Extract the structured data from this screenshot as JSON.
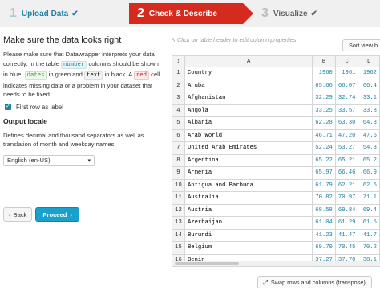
{
  "steps": [
    {
      "num": "1",
      "label": "Upload Data",
      "done": true
    },
    {
      "num": "2",
      "label": "Check & Describe",
      "done": true
    },
    {
      "num": "3",
      "label": "Visualize",
      "done": true
    }
  ],
  "left": {
    "heading": "Make sure the data looks right",
    "desc_1": "Please make sure that Datawrapper interprets your data correctly. In the table ",
    "code_number": "number",
    "desc_2": " columns should be shown in blue, ",
    "code_dates": "dates",
    "desc_3": " in green and ",
    "code_text": "text",
    "desc_4": " in black. A ",
    "code_red": "red",
    "desc_5": " cell indicates missing data or a problem in your dataset that needs to be fixed.",
    "first_row_label": "First row as label",
    "first_row_checked": true,
    "locale_heading": "Output locale",
    "locale_desc": "Defines decimal and thousand separators as well as translation of month and weekday names.",
    "locale_value": "English (en-US)",
    "back_label": "Back",
    "proceed_label": "Proceed"
  },
  "hint": "Click on table header to edit column properties",
  "sort_label": "Sort view b",
  "transpose_label": "Swap rows and columns (transpose)",
  "table": {
    "corner": "↕",
    "col_letters": [
      "A",
      "B",
      "C",
      "D"
    ],
    "header_row": {
      "rn": "1",
      "cells": [
        "Country",
        "1960",
        "1961",
        "1962"
      ]
    },
    "rows": [
      {
        "rn": "2",
        "cells": [
          "Aruba",
          "65.66",
          "66.07",
          "66.4"
        ]
      },
      {
        "rn": "3",
        "cells": [
          "Afghanistan",
          "32.29",
          "32.74",
          "33.1"
        ]
      },
      {
        "rn": "4",
        "cells": [
          "Angola",
          "33.25",
          "33.57",
          "33.8"
        ]
      },
      {
        "rn": "5",
        "cells": [
          "Albania",
          "62.28",
          "63.30",
          "64.3"
        ]
      },
      {
        "rn": "6",
        "cells": [
          "Arab World",
          "46.71",
          "47.20",
          "47.6"
        ]
      },
      {
        "rn": "7",
        "cells": [
          "United Arab Emirates",
          "52.24",
          "53.27",
          "54.3"
        ]
      },
      {
        "rn": "8",
        "cells": [
          "Argentina",
          "65.22",
          "65.21",
          "65.2"
        ]
      },
      {
        "rn": "9",
        "cells": [
          "Armenia",
          "65.97",
          "66.46",
          "66.9"
        ]
      },
      {
        "rn": "10",
        "cells": [
          "Antigua and Barbuda",
          "61.79",
          "62.21",
          "62.6"
        ]
      },
      {
        "rn": "11",
        "cells": [
          "Australia",
          "70.82",
          "70.97",
          "71.1"
        ]
      },
      {
        "rn": "12",
        "cells": [
          "Austria",
          "68.58",
          "69.84",
          "69.4"
        ]
      },
      {
        "rn": "13",
        "cells": [
          "Azerbaijan",
          "61.04",
          "61.29",
          "61.5"
        ]
      },
      {
        "rn": "14",
        "cells": [
          "Burundi",
          "41.23",
          "41.47",
          "41.7"
        ]
      },
      {
        "rn": "15",
        "cells": [
          "Belgium",
          "69.70",
          "70.45",
          "70.2"
        ]
      },
      {
        "rn": "16",
        "cells": [
          "Benin",
          "37.27",
          "37.70",
          "38.1"
        ]
      }
    ]
  }
}
